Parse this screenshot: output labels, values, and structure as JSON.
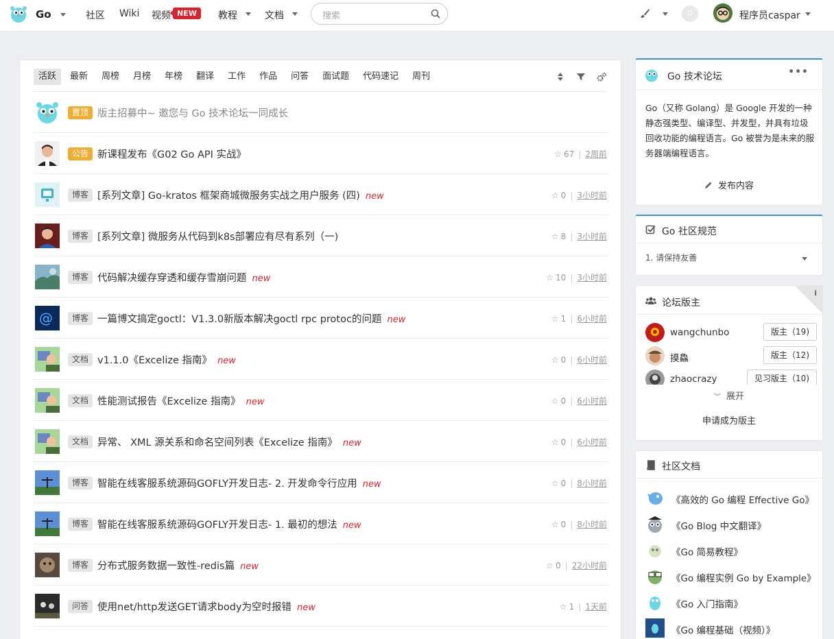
{
  "nav": {
    "brand": "Go",
    "items": [
      "社区",
      "Wiki",
      "视频",
      "教程",
      "文档"
    ],
    "video_badge": "NEW",
    "search_placeholder": "搜索",
    "notification_count": "0",
    "username": "程序员caspar"
  },
  "tabs": [
    "活跃",
    "最新",
    "周榜",
    "月榜",
    "年榜",
    "翻译",
    "工作",
    "作品",
    "问答",
    "面试题",
    "代码速记",
    "周刊"
  ],
  "active_tab": "活跃",
  "topics": [
    {
      "node": "置顶",
      "title": "版主招募中~ 邀您与 Go 技术论坛一同成长",
      "is_new": false,
      "stars": "",
      "time": ""
    },
    {
      "node": "公告",
      "title": "新课程发布《G02 Go API 实战》",
      "is_new": false,
      "stars": "67",
      "time": "2周前"
    },
    {
      "node": "博客",
      "title": "[系列文章] Go-kratos 框架商城微服务实战之用户服务 (四)",
      "is_new": true,
      "stars": "0",
      "time": "3小时前"
    },
    {
      "node": "博客",
      "title": "[系列文章] 微服务从代码到k8s部署应有尽有系列（一)",
      "is_new": false,
      "stars": "8",
      "time": "3小时前"
    },
    {
      "node": "博客",
      "title": "代码解决缓存穿透和缓存雪崩问题",
      "is_new": true,
      "stars": "10",
      "time": "3小时前"
    },
    {
      "node": "博客",
      "title": "一篇博文搞定goctl：V1.3.0新版本解决goctl rpc protoc的问题",
      "is_new": true,
      "stars": "1",
      "time": "6小时前"
    },
    {
      "node": "文档",
      "title": "v1.1.0《Excelize 指南》",
      "is_new": true,
      "stars": "0",
      "time": "6小时前"
    },
    {
      "node": "文档",
      "title": "性能测试报告《Excelize 指南》",
      "is_new": true,
      "stars": "0",
      "time": "6小时前"
    },
    {
      "node": "文档",
      "title": "异常、 XML 源关系和命名空间列表《Excelize 指南》",
      "is_new": true,
      "stars": "0",
      "time": "6小时前"
    },
    {
      "node": "博客",
      "title": "智能在线客服系统源码GOFLY开发日志- 2. 开发命令行应用",
      "is_new": true,
      "stars": "0",
      "time": "8小时前"
    },
    {
      "node": "博客",
      "title": "智能在线客服系统源码GOFLY开发日志- 1. 最初的想法",
      "is_new": true,
      "stars": "0",
      "time": "8小时前"
    },
    {
      "node": "博客",
      "title": "分布式服务数据一致性-redis篇",
      "is_new": true,
      "stars": "0",
      "time": "22小时前"
    },
    {
      "node": "问答",
      "title": "使用net/http发送GET请求body为空时报错",
      "is_new": true,
      "stars": "1",
      "time": "1天前"
    }
  ],
  "new_label": "new",
  "sidebar": {
    "forum": {
      "title": "Go 技术论坛",
      "more": "•••",
      "description": "Go（又称 Golang）是 Google 开发的一种静态强类型、编译型、并发型，并具有垃圾回收功能的编程语言。Go 被誉为是未来的服务器端编程语言。",
      "publish_label": "发布内容"
    },
    "rules": {
      "title": "Go 社区规范",
      "first_rule": "1. 请保持友善"
    },
    "moderators": {
      "title": "论坛版主",
      "info": "i",
      "list": [
        {
          "name": "wangchunbo",
          "role": "版主（19)"
        },
        {
          "name": "摸鱻",
          "role": "版主（12)"
        },
        {
          "name": "zhaocrazy",
          "role": "见习版主（10)"
        }
      ],
      "expand_label": "展开",
      "apply_label": "申请成为版主"
    },
    "docs": {
      "title": "社区文档",
      "list": [
        "《高效的 Go 编程 Effective Go》",
        "《Go Blog 中文翻译》",
        "《Go 简易教程》",
        "《Go 编程实例 Go by Example》",
        "《Go 入门指南》",
        "《Go 编程基础（视频）》"
      ]
    }
  },
  "colors": {
    "accent": "#3a8ee6",
    "new_red": "#d9232d",
    "pin_orange": "#f0ad32",
    "gopher_blue": "#6ad7e5"
  }
}
